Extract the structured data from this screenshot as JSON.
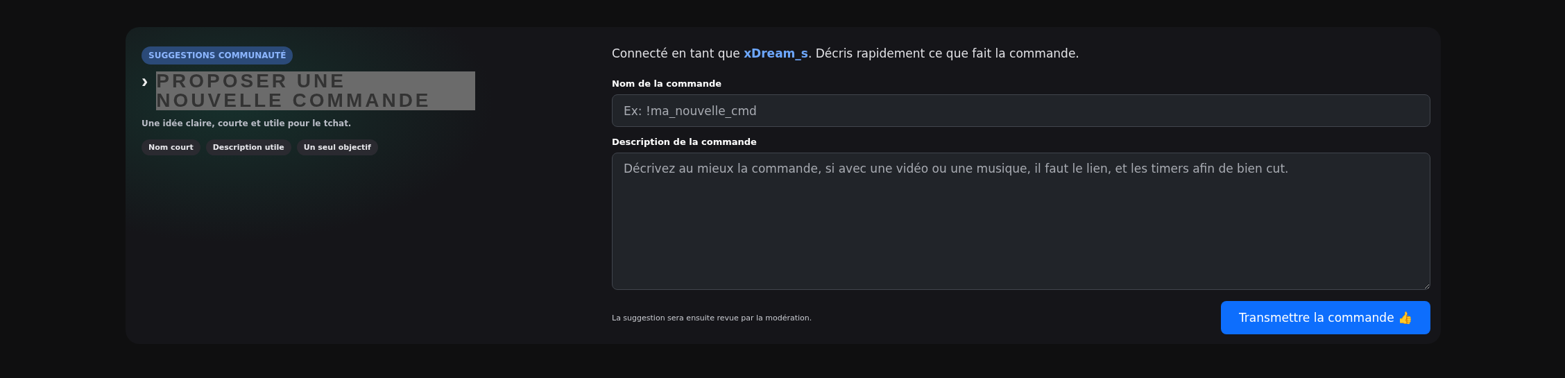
{
  "badge": "SUGGESTIONS COMMUNAUTÉ",
  "title": {
    "prefix": "›",
    "text": "PROPOSER UNE NOUVELLE COMMANDE",
    "selected": true
  },
  "subtitle": "Une idée claire, courte et utile pour le tchat.",
  "tags": [
    "Nom court",
    "Description utile",
    "Un seul objectif"
  ],
  "intro": "Connecté en tant que **xDream_s**. Décris rapidement ce que fait la commande.",
  "fields": [
    {
      "kind": "input",
      "label": "Nom de la commande",
      "placeholder": "Ex: !ma_nouvelle_cmd"
    },
    {
      "kind": "textarea",
      "label": "Description de la commande",
      "placeholder": "Décrivez au mieux la commande, si avec une vidéo ou une musique, il faut le lien, et les timers afin de bien cut."
    }
  ],
  "note": "La suggestion sera ensuite revue par la modération.",
  "submit": "Transmettre la commande 👍"
}
